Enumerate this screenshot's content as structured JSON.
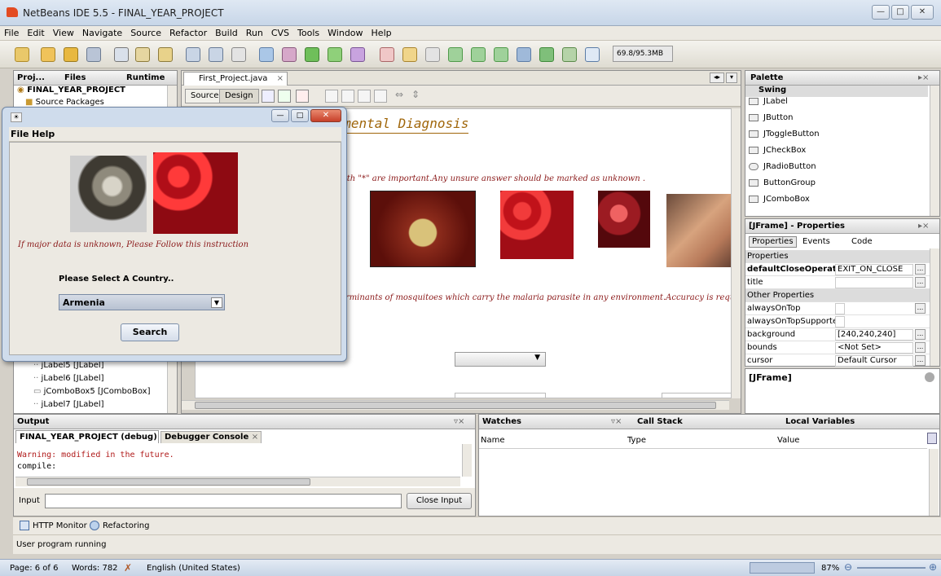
{
  "window": {
    "title": "NetBeans IDE 5.5 - FINAL_YEAR_PROJECT"
  },
  "menubar": [
    "File",
    "Edit",
    "View",
    "Navigate",
    "Source",
    "Refactor",
    "Build",
    "Run",
    "CVS",
    "Tools",
    "Window",
    "Help"
  ],
  "toolbar": {
    "memory": "69.8/95.3MB"
  },
  "project_panel": {
    "tabs": [
      "Proj...",
      "Files",
      "Runtime"
    ],
    "root": "FINAL_YEAR_PROJECT",
    "source_packages": "Source Packages",
    "tree_items": [
      "jLabel5 [JLabel]",
      "jLabel6 [JLabel]",
      "jComboBox5 [JComboBox]",
      "jLabel7 [JLabel]"
    ]
  },
  "editor": {
    "file_tab": "First_Project.java",
    "source_label": "Source",
    "design_label": "Design",
    "heading": "laria Environmental Diagnosis",
    "note1": "with \"*\" are important.Any unsure answer should be marked as unknown .",
    "note2": "erminants of mosquitoes which carry the malaria parasite in any environment.Accuracy is requ"
  },
  "palette": {
    "title": "Palette",
    "category": "Swing",
    "items": [
      "JLabel",
      "JButton",
      "JToggleButton",
      "JCheckBox",
      "JRadioButton",
      "ButtonGroup",
      "JComboBox"
    ]
  },
  "properties": {
    "title": "[JFrame] - Properties",
    "tabs": [
      "Properties",
      "Events",
      "Code"
    ],
    "section1": "Properties",
    "section2": "Other Properties",
    "rows": [
      {
        "key": "defaultCloseOperation",
        "value": "EXIT_ON_CLOSE"
      },
      {
        "key": "title",
        "value": ""
      },
      {
        "key": "alwaysOnTop",
        "value": ""
      },
      {
        "key": "alwaysOnTopSupported",
        "value": ""
      },
      {
        "key": "background",
        "value": "[240,240,240]"
      },
      {
        "key": "bounds",
        "value": "<Not Set>"
      },
      {
        "key": "cursor",
        "value": "Default Cursor"
      }
    ]
  },
  "jframe_panel": {
    "title": "[JFrame]"
  },
  "dialog": {
    "menu": [
      "File",
      "Help"
    ],
    "instruction": "If major data is unknown, Please Follow this instruction",
    "country_label": "Please Select A Country..",
    "country_selected": "Armenia",
    "search_label": "Search"
  },
  "output": {
    "title": "Output",
    "tab1": "FINAL_YEAR_PROJECT (debug)",
    "tab2": "Debugger Console",
    "lines": [
      "Warning:  modified in the future.",
      "compile:"
    ],
    "input_label": "Input",
    "close_input": "Close Input"
  },
  "watches": {
    "tabs": [
      "Watches",
      "Call Stack",
      "Local Variables"
    ],
    "columns": [
      "Name",
      "Type",
      "Value"
    ]
  },
  "bottom_tabs": [
    "HTTP Monitor",
    "Refactoring"
  ],
  "status": "User program running",
  "wordbar": {
    "page": "Page: 6 of 6",
    "words": "Words: 782",
    "language": "English (United States)",
    "zoom": "87%"
  }
}
